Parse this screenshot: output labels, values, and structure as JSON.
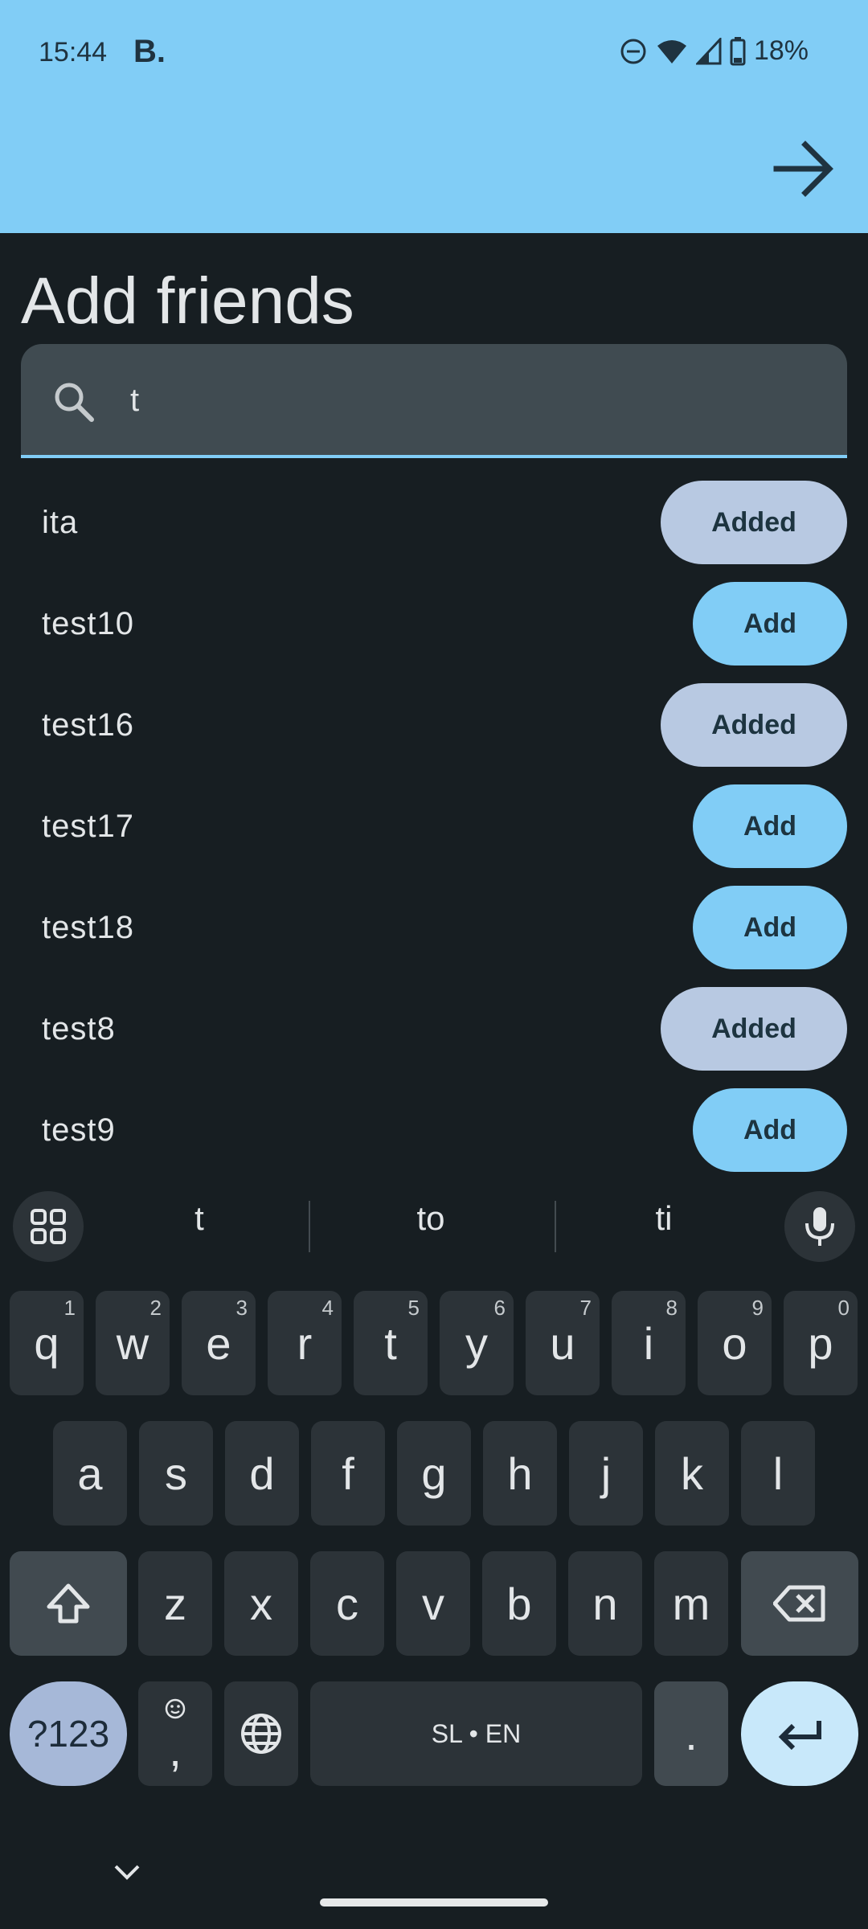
{
  "status_bar": {
    "time": "15:44",
    "app_badge": "B.",
    "battery": "18%",
    "icons": [
      "do-not-disturb-icon",
      "wifi-icon",
      "signal-icon",
      "battery-icon"
    ]
  },
  "header": {
    "forward_icon": "arrow-right-icon",
    "title": "Add friends"
  },
  "search": {
    "icon": "search-icon",
    "value": "t"
  },
  "results": [
    {
      "name": "ita",
      "action": "Added"
    },
    {
      "name": "test10",
      "action": "Add"
    },
    {
      "name": "test16",
      "action": "Added"
    },
    {
      "name": "test17",
      "action": "Add"
    },
    {
      "name": "test18",
      "action": "Add"
    },
    {
      "name": "test8",
      "action": "Added"
    },
    {
      "name": "test9",
      "action": "Add"
    }
  ],
  "keyboard": {
    "suggestions": [
      "t",
      "to",
      "ti"
    ],
    "row1": [
      {
        "k": "q",
        "n": "1"
      },
      {
        "k": "w",
        "n": "2"
      },
      {
        "k": "e",
        "n": "3"
      },
      {
        "k": "r",
        "n": "4"
      },
      {
        "k": "t",
        "n": "5"
      },
      {
        "k": "y",
        "n": "6"
      },
      {
        "k": "u",
        "n": "7"
      },
      {
        "k": "i",
        "n": "8"
      },
      {
        "k": "o",
        "n": "9"
      },
      {
        "k": "p",
        "n": "0"
      }
    ],
    "row2": [
      "a",
      "s",
      "d",
      "f",
      "g",
      "h",
      "j",
      "k",
      "l"
    ],
    "row3": [
      "z",
      "x",
      "c",
      "v",
      "b",
      "n",
      "m"
    ],
    "symbols_key": "?123",
    "comma_key": ",",
    "space_label": "SL • EN",
    "period_key": "."
  },
  "colors": {
    "accent": "#81cdf6",
    "added_pill": "#b8c9e2",
    "background": "#171e22"
  }
}
